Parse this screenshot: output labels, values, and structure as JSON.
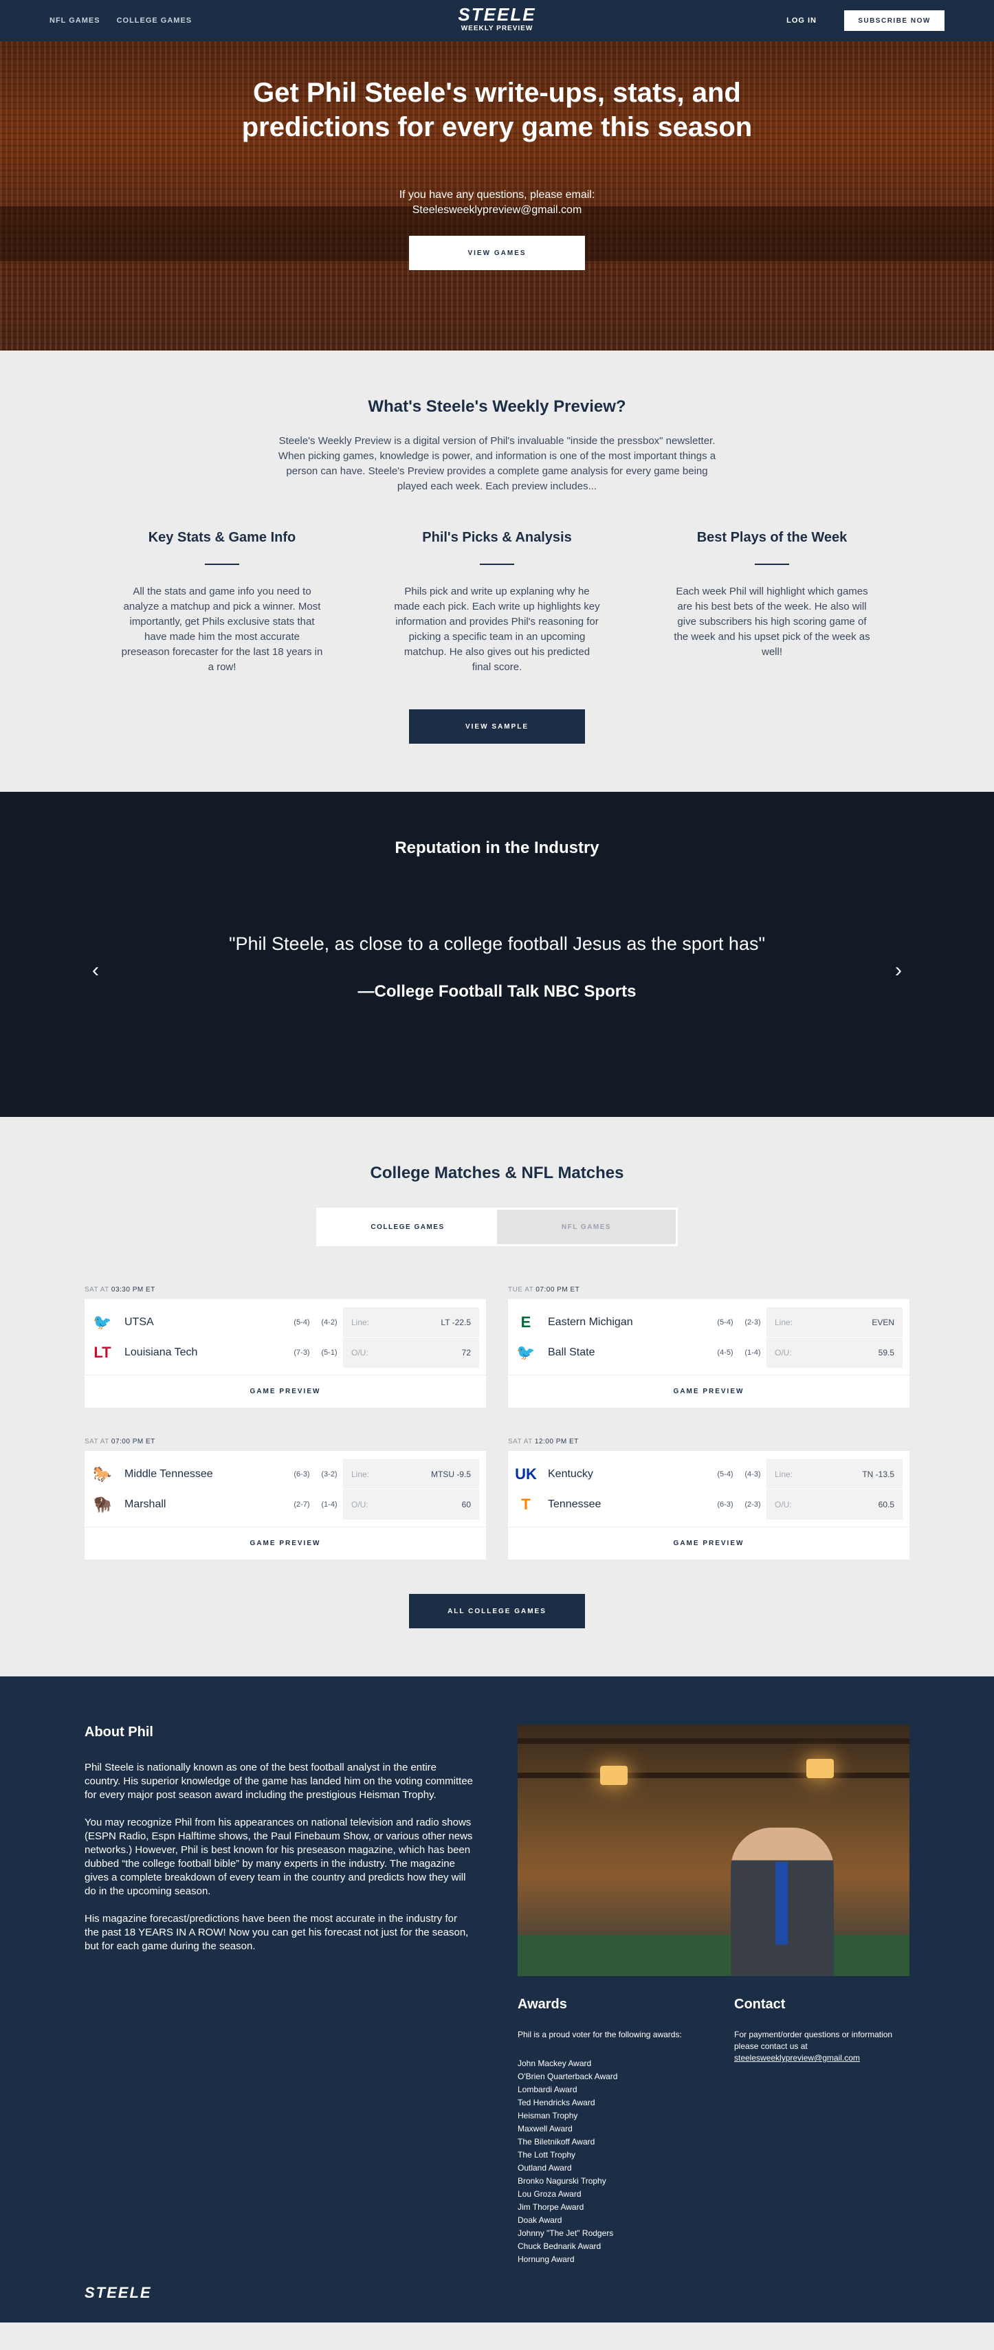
{
  "nav": {
    "links": [
      "NFL GAMES",
      "COLLEGE GAMES"
    ],
    "brand": "STEELE",
    "brand_sub": "WEEKLY PREVIEW",
    "login": "LOG IN",
    "subscribe": "SUBSCRIBE NOW"
  },
  "hero": {
    "title": "Get Phil Steele's write-ups, stats, and predictions for every game this season",
    "question": "If you have any questions, please email:",
    "email": "Steelesweeklypreview@gmail.com",
    "button": "VIEW GAMES"
  },
  "preview": {
    "title": "What's Steele's Weekly Preview?",
    "intro": "Steele's Weekly Preview is a digital version of Phil's invaluable \"inside the pressbox\" newsletter. When picking games, knowledge is power, and information is one of the most important things a person can have. Steele's Preview provides a complete game analysis for every game being played each week. Each preview includes...",
    "features": [
      {
        "title": "Key Stats & Game Info",
        "text": "All the stats and game info you need to analyze a matchup and pick a winner. Most importantly, get Phils exclusive stats that have made him the most accurate preseason forecaster for the last 18 years in a row!"
      },
      {
        "title": "Phil's Picks & Analysis",
        "text": "Phils pick and write up explaning why he made each pick. Each write up highlights key information and provides Phil's reasoning for picking a specific team in an upcoming matchup. He also gives out his predicted final score."
      },
      {
        "title": "Best Plays of the Week",
        "text": "Each week Phil will highlight which games are his best bets of the week. He also will give subscribers his high scoring game of the week and his upset pick of the week as well!"
      }
    ],
    "button": "VIEW SAMPLE"
  },
  "reputation": {
    "title": "Reputation in the Industry",
    "quote": "\"Phil Steele, as close to a college football Jesus as the sport has\"",
    "source": "—College Football Talk NBC Sports"
  },
  "matches": {
    "title": "College Matches & NFL Matches",
    "tabs": [
      "COLLEGE GAMES",
      "NFL GAMES"
    ],
    "games": [
      {
        "day": "SAT AT",
        "time": "03:30 PM ET",
        "team1": {
          "name": "UTSA",
          "rec1": "(5-4)",
          "rec2": "(4-2)",
          "logo": "roadrunner-logo",
          "color": "#0c2340",
          "glyph": "🐦"
        },
        "team2": {
          "name": "Louisiana Tech",
          "rec1": "(7-3)",
          "rec2": "(5-1)",
          "logo": "la-tech-logo",
          "color": "#c8102e",
          "glyph": "LT"
        },
        "line_label": "Line:",
        "line": "LT -22.5",
        "ou_label": "O/U:",
        "ou": "72",
        "cta": "GAME PREVIEW"
      },
      {
        "day": "TUE AT",
        "time": "07:00 PM ET",
        "team1": {
          "name": "Eastern Michigan",
          "rec1": "(5-4)",
          "rec2": "(2-3)",
          "logo": "eastern-michigan-logo",
          "color": "#046a38",
          "glyph": "E"
        },
        "team2": {
          "name": "Ball State",
          "rec1": "(4-5)",
          "rec2": "(1-4)",
          "logo": "ball-state-logo",
          "color": "#ba0c2f",
          "glyph": "🐦"
        },
        "line_label": "Line:",
        "line": "EVEN",
        "ou_label": "O/U:",
        "ou": "59.5",
        "cta": "GAME PREVIEW"
      },
      {
        "day": "SAT AT",
        "time": "07:00 PM ET",
        "team1": {
          "name": "Middle Tennessee",
          "rec1": "(6-3)",
          "rec2": "(3-2)",
          "logo": "middle-tennessee-logo",
          "color": "#0066cc",
          "glyph": "🐎"
        },
        "team2": {
          "name": "Marshall",
          "rec1": "(2-7)",
          "rec2": "(1-4)",
          "logo": "marshall-logo",
          "color": "#00b140",
          "glyph": "🦬"
        },
        "line_label": "Line:",
        "line": "MTSU -9.5",
        "ou_label": "O/U:",
        "ou": "60",
        "cta": "GAME PREVIEW"
      },
      {
        "day": "SAT AT",
        "time": "12:00 PM ET",
        "team1": {
          "name": "Kentucky",
          "rec1": "(5-4)",
          "rec2": "(4-3)",
          "logo": "kentucky-logo",
          "color": "#0033a0",
          "glyph": "UK"
        },
        "team2": {
          "name": "Tennessee",
          "rec1": "(6-3)",
          "rec2": "(2-3)",
          "logo": "tennessee-logo",
          "color": "#ff8200",
          "glyph": "T"
        },
        "line_label": "Line:",
        "line": "TN -13.5",
        "ou_label": "O/U:",
        "ou": "60.5",
        "cta": "GAME PREVIEW"
      }
    ],
    "button": "ALL COLLEGE GAMES"
  },
  "about": {
    "title": "About Phil",
    "paragraphs": [
      "Phil Steele is nationally known as one of the best football analyst in the entire country.   His superior knowledge of the game has landed him on the voting committee for every major post season award including the prestigious Heisman Trophy.",
      "You may recognize Phil from his appearances on national television and radio shows (ESPN Radio, Espn Halftime shows, the Paul Finebaum Show, or various other news networks.) However, Phil is best known for his preseason magazine, which has been dubbed “the college football bible” by many experts in the industry. The magazine gives a complete breakdown of every team in the country and predicts how they will do in the upcoming season.",
      "His magazine forecast/predictions have been the most accurate in the industry for the past 18 YEARS IN A ROW! Now you can get his forecast not just for the season, but for each game during the season."
    ],
    "awards_title": "Awards",
    "awards_intro": "Phil is a proud voter for the following awards:",
    "awards": [
      "John Mackey Award",
      "O'Brien Quarterback Award",
      "Lombardi Award",
      "Ted Hendricks Award",
      "Heisman Trophy",
      "Maxwell Award",
      "The Biletnikoff Award",
      "The Lott Trophy",
      "Outland Award",
      "Bronko Nagurski Trophy",
      "Lou Groza Award",
      "Jim Thorpe Award",
      "Doak Award",
      "Johnny \"The Jet\" Rodgers",
      "Chuck Bednarik Award",
      "Hornung Award"
    ],
    "contact_title": "Contact",
    "contact_text": "For payment/order questions or information please contact us at",
    "contact_email": "steelesweeklypreview@gmail.com",
    "footer_logo": "STEELE"
  },
  "colors": {
    "navy": "#1c2e45",
    "dark": "#111a25",
    "bg": "#ececec"
  }
}
